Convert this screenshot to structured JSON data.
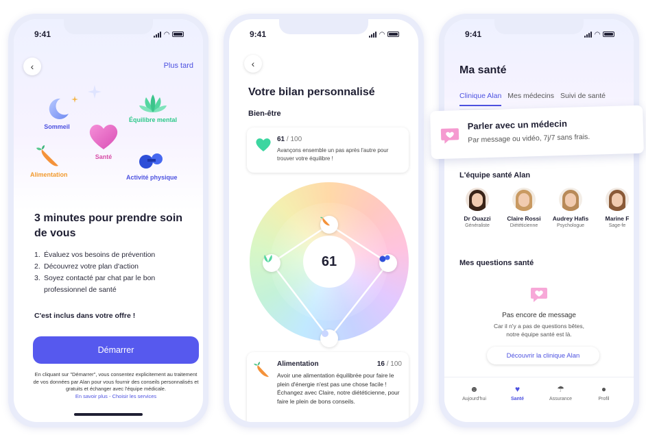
{
  "status_time": "9:41",
  "screen1": {
    "later": "Plus tard",
    "topics": {
      "sommeil": "Sommeil",
      "equilibre": "Équilibre mental",
      "sante": "Santé",
      "alimentation": "Alimentation",
      "activite": "Activité physique"
    },
    "title": "3 minutes pour prendre soin de vous",
    "steps": [
      {
        "num": "1.",
        "text": "Évaluez vos besoins de prévention"
      },
      {
        "num": "2.",
        "text": "Découvrez votre plan d'action"
      },
      {
        "num": "3.",
        "text": "Soyez contacté par chat par le bon professionnel de santé"
      }
    ],
    "included": "C'est inclus dans votre offre !",
    "cta": "Démarrer",
    "legal": "En cliquant sur \"Démarrer\", vous consentez explicitement au traitement de vos données par Alan pour vous fournir des conseils personnalisés et gratuits et échanger avec l'équipe médicale.",
    "legal_links": "En savoir plus - Choisir les services"
  },
  "screen2": {
    "title": "Votre bilan personnalisé",
    "section": "Bien-être",
    "score_value": "61",
    "score_max": "/ 100",
    "score_text": "Avançons ensemble un pas après l'autre pour trouver votre équilibre !",
    "wheel_score": "61",
    "detail": {
      "title": "Alimentation",
      "score": "16",
      "max": "/ 100",
      "text": "Avoir une alimentation équilibrée pour faire le plein d'énergie n'est pas une chose facile ! Échangez avec Claire, notre diététicienne, pour faire le plein de bons conseils."
    }
  },
  "screen3": {
    "title": "Ma santé",
    "tabs": [
      "Clinique Alan",
      "Mes médecins",
      "Suivi de santé"
    ],
    "banner_title": "Parler avec un médecin",
    "banner_sub": "Par message ou vidéo, 7j/7 sans frais.",
    "team_title": "L'équipe santé Alan",
    "team": [
      {
        "name": "Dr Ouazzi",
        "role": "Généraliste"
      },
      {
        "name": "Claire Rossi",
        "role": "Diététicienne"
      },
      {
        "name": "Audrey Hafis",
        "role": "Psychologue"
      },
      {
        "name": "Marine F",
        "role": "Sage-fe"
      }
    ],
    "questions_title": "Mes questions santé",
    "empty_title": "Pas encore de message",
    "empty_text_1": "Car il n'y a pas de questions bêtes,",
    "empty_text_2": "notre équipe santé est là.",
    "discover": "Découvrir la clinique Alan",
    "nav": [
      "Aujourd'hui",
      "Santé",
      "Assurance",
      "Profil"
    ]
  },
  "colors": {
    "accent": "#5659ee",
    "heart": "#e86fc8",
    "green": "#3dd6a0"
  }
}
